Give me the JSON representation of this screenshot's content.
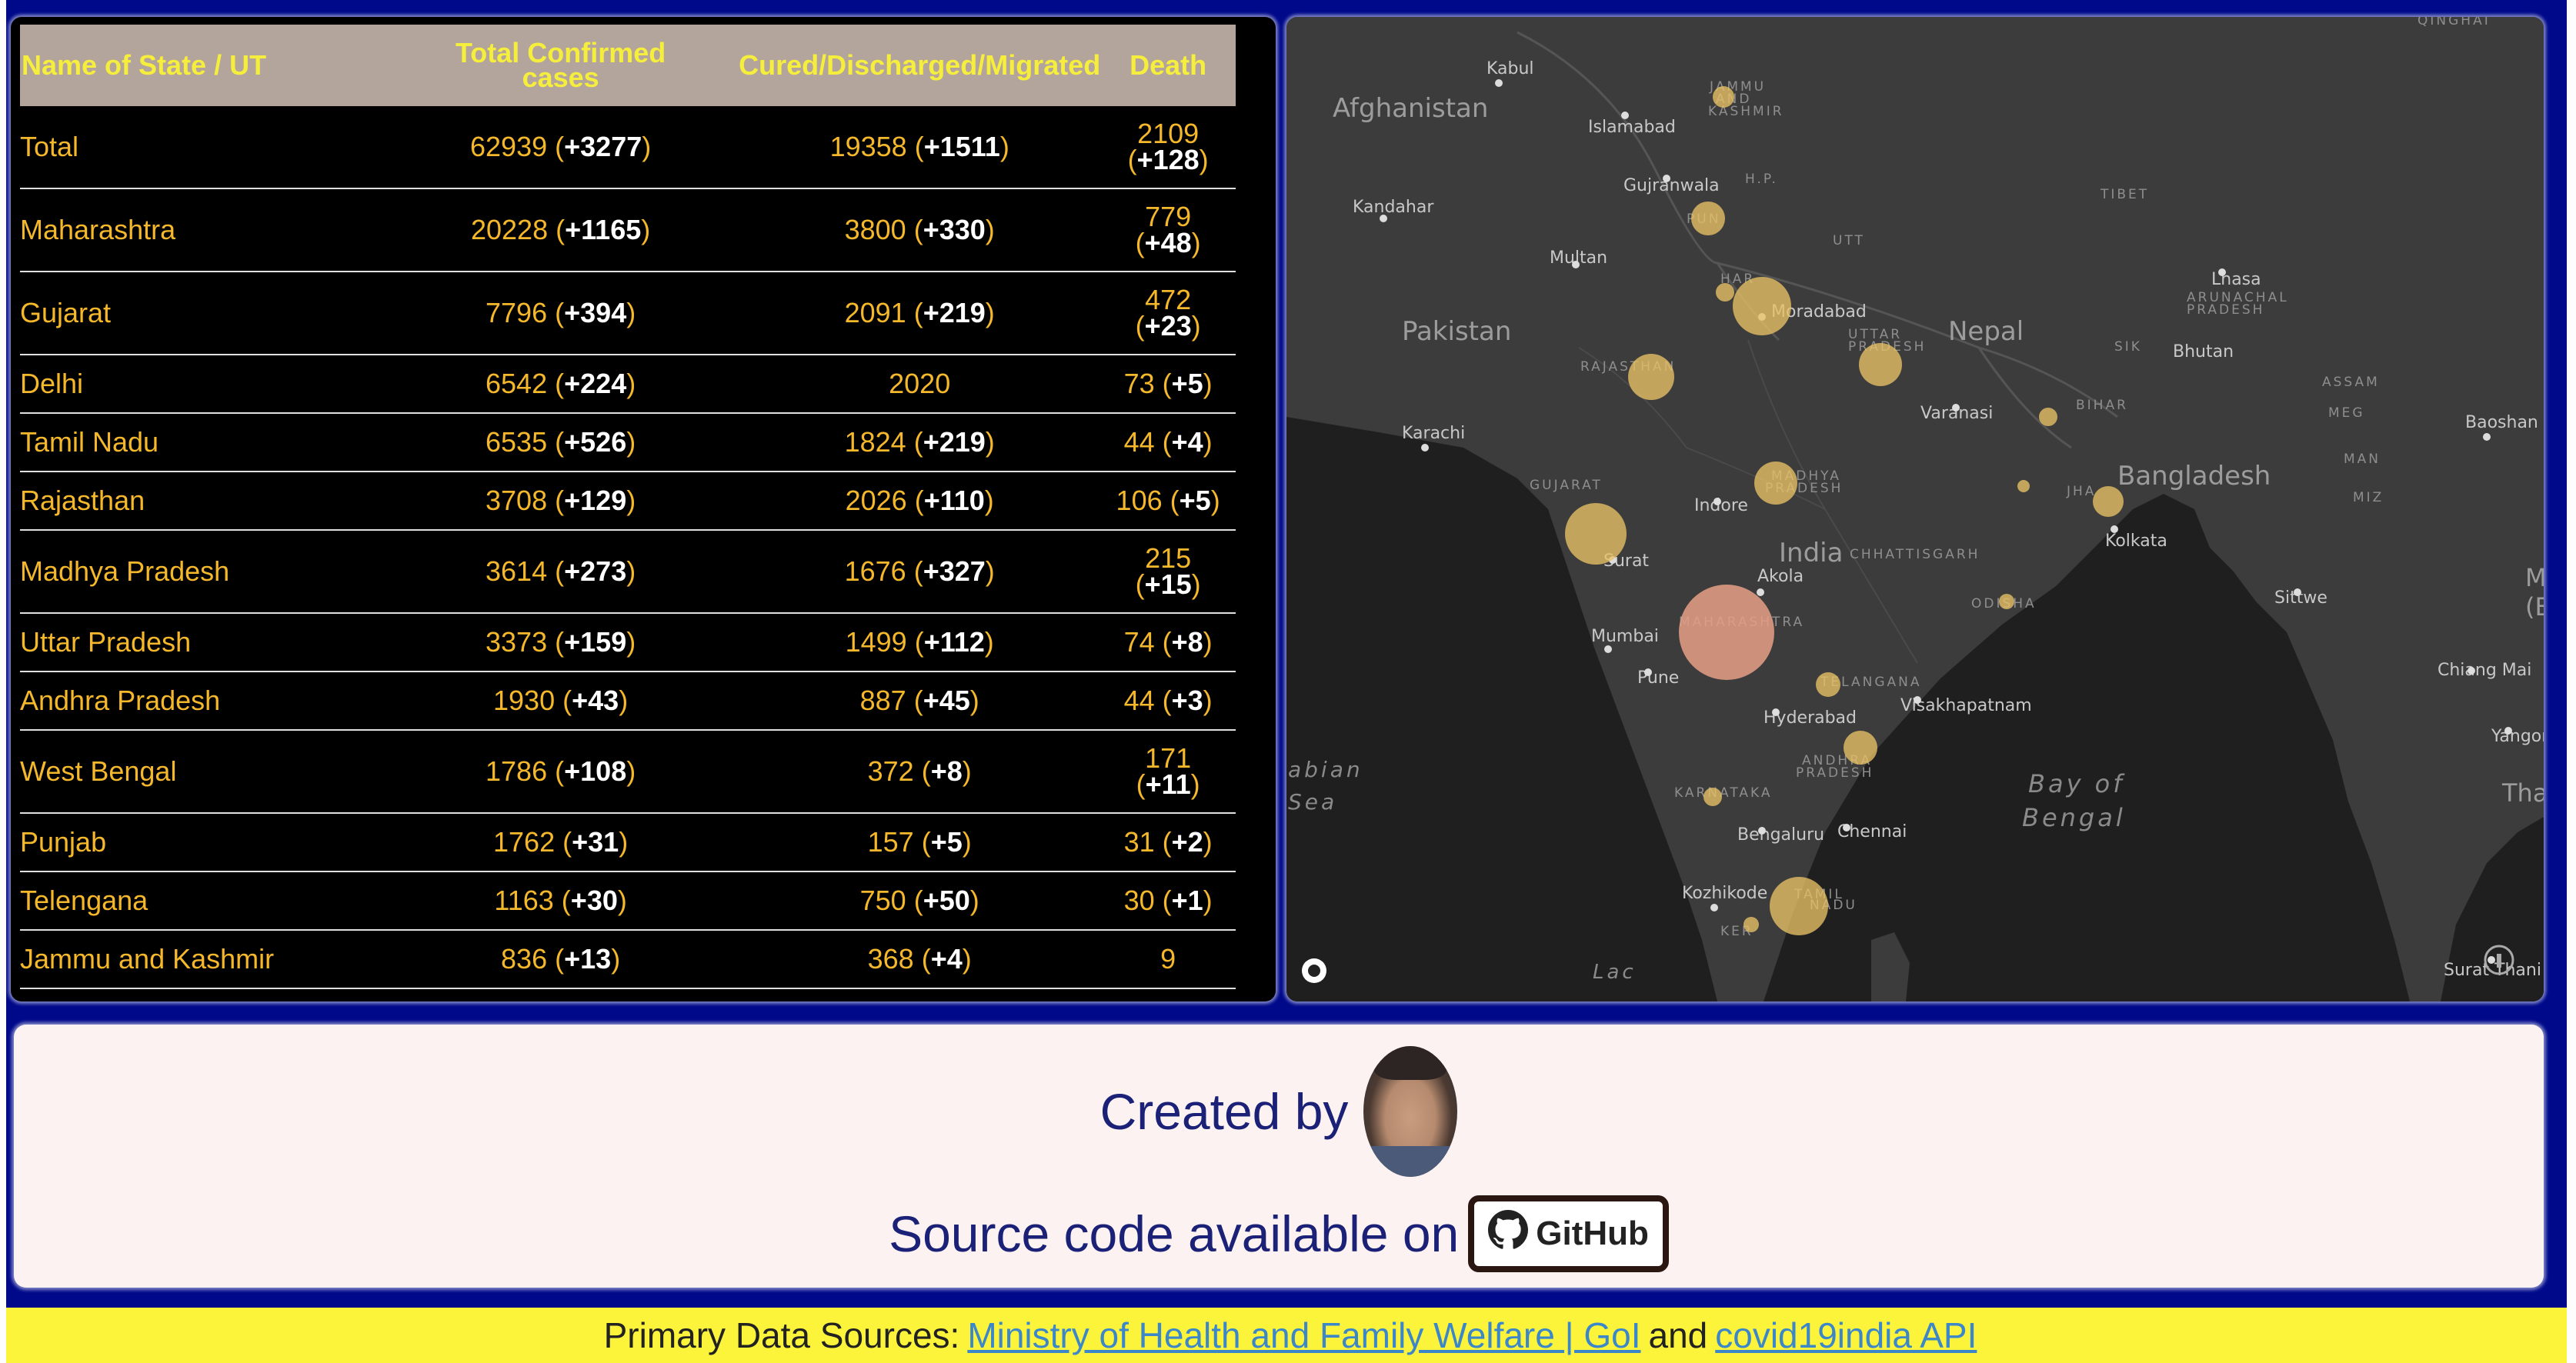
{
  "table": {
    "headers": {
      "state": "Name of State / UT",
      "confirmed_line1": "Total Confirmed",
      "confirmed_line2": "cases",
      "cured": "Cured/Discharged/Migrated",
      "death": "Death"
    },
    "rows": [
      {
        "state": "Total",
        "confirmed": "62939",
        "confirmed_inc": "+3277",
        "cured": "19358",
        "cured_inc": "+1511",
        "death": "2109",
        "death_inc": "+128"
      },
      {
        "state": "Maharashtra",
        "confirmed": "20228",
        "confirmed_inc": "+1165",
        "cured": "3800",
        "cured_inc": "+330",
        "death": "779",
        "death_inc": "+48"
      },
      {
        "state": "Gujarat",
        "confirmed": "7796",
        "confirmed_inc": "+394",
        "cured": "2091",
        "cured_inc": "+219",
        "death": "472",
        "death_inc": "+23"
      },
      {
        "state": "Delhi",
        "confirmed": "6542",
        "confirmed_inc": "+224",
        "cured": "2020",
        "cured_inc": "",
        "death": "73",
        "death_inc": "+5"
      },
      {
        "state": "Tamil Nadu",
        "confirmed": "6535",
        "confirmed_inc": "+526",
        "cured": "1824",
        "cured_inc": "+219",
        "death": "44",
        "death_inc": "+4"
      },
      {
        "state": "Rajasthan",
        "confirmed": "3708",
        "confirmed_inc": "+129",
        "cured": "2026",
        "cured_inc": "+110",
        "death": "106",
        "death_inc": "+5"
      },
      {
        "state": "Madhya Pradesh",
        "confirmed": "3614",
        "confirmed_inc": "+273",
        "cured": "1676",
        "cured_inc": "+327",
        "death": "215",
        "death_inc": "+15"
      },
      {
        "state": "Uttar Pradesh",
        "confirmed": "3373",
        "confirmed_inc": "+159",
        "cured": "1499",
        "cured_inc": "+112",
        "death": "74",
        "death_inc": "+8"
      },
      {
        "state": "Andhra Pradesh",
        "confirmed": "1930",
        "confirmed_inc": "+43",
        "cured": "887",
        "cured_inc": "+45",
        "death": "44",
        "death_inc": "+3"
      },
      {
        "state": "West Bengal",
        "confirmed": "1786",
        "confirmed_inc": "+108",
        "cured": "372",
        "cured_inc": "+8",
        "death": "171",
        "death_inc": "+11"
      },
      {
        "state": "Punjab",
        "confirmed": "1762",
        "confirmed_inc": "+31",
        "cured": "157",
        "cured_inc": "+5",
        "death": "31",
        "death_inc": "+2"
      },
      {
        "state": "Telengana",
        "confirmed": "1163",
        "confirmed_inc": "+30",
        "cured": "750",
        "cured_inc": "+50",
        "death": "30",
        "death_inc": "+1"
      },
      {
        "state": "Jammu and Kashmir",
        "confirmed": "836",
        "confirmed_inc": "+13",
        "cured": "368",
        "cured_inc": "+4",
        "death": "9",
        "death_inc": ""
      }
    ]
  },
  "map": {
    "countries": [
      "Afghanistan",
      "Pakistan",
      "Nepal",
      "India",
      "Bangladesh",
      "Myanmar",
      "(Burma)",
      "Tha"
    ],
    "cities": [
      "Kabul",
      "Islamabad",
      "Gujranwala",
      "Kandahar",
      "Multan",
      "Moradabad",
      "Lhasa",
      "Bhutan",
      "Karachi",
      "Varanasi",
      "Baoshan",
      "Indore",
      "Kolkata",
      "Surat",
      "Akola",
      "Sittwe",
      "Mumbai",
      "Pune",
      "Hyderabad",
      "Visakhapatnam",
      "Chiang Mai",
      "Yangon",
      "Bengaluru",
      "Chennai",
      "Kozhikode",
      "Surat Thani"
    ],
    "regions": [
      "JAMMU",
      "AND",
      "KASHMIR",
      "H.P.",
      "PUN",
      "UTT",
      "HAR",
      "TIBET",
      "UTTAR",
      "PRADESH",
      "ARUNACHAL",
      "PRADESH",
      "SIK",
      "ASSAM",
      "RAJASTHAN",
      "BIHAR",
      "MEG",
      "MAN",
      "GUJARAT",
      "MADHYA",
      "PRADESH",
      "JHA",
      "MIZ",
      "CHHATTISGARH",
      "ODISHA",
      "MAHARASHTRA",
      "TELANGANA",
      "ANDHRA",
      "PRADESH",
      "KARNATAKA",
      "TAMIL",
      "NADU",
      "KER",
      "QINGHAI"
    ],
    "seas": [
      "abian",
      "Sea",
      "Bay of",
      "Bengal",
      "Lac"
    ],
    "colors": {
      "land": "#3c3c3c",
      "water": "#1e1e1e",
      "bubble": "#e9c165",
      "bubble_max": "#e59f86"
    }
  },
  "credits": {
    "created_by": "Created by",
    "source_code": "Source code available on",
    "github_label": "GitHub"
  },
  "footer": {
    "prefix": "Primary Data Sources:",
    "link1": "Ministry of Health and Family Welfare | GoI",
    "conjunction": "and",
    "link2": "covid19india API"
  },
  "colors": {
    "frame": "#00098a",
    "header_bg": "#b3a49c",
    "header_text": "#f6ee3c",
    "cell_text": "#f5b82b",
    "footer_bg": "#fbf43a",
    "credits_text": "#1a2176"
  }
}
